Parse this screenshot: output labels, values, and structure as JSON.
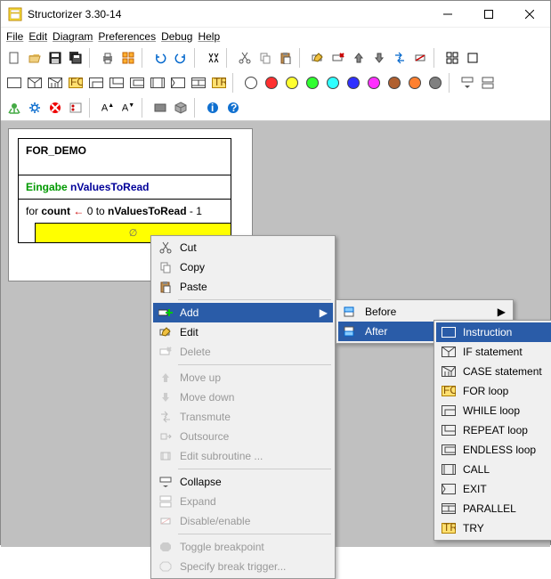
{
  "window": {
    "title": "Structorizer 3.30-14"
  },
  "menu": {
    "file": "File",
    "edit": "Edit",
    "diagram": "Diagram",
    "preferences": "Preferences",
    "debug": "Debug",
    "help": "Help"
  },
  "toolbar_colors": [
    "#ffffff",
    "#ff3030",
    "#ffff30",
    "#30ff30",
    "#30ffff",
    "#3030ff",
    "#ff30ff",
    "#b06030",
    "#ff8030",
    "#808080"
  ],
  "diagram": {
    "name": "FOR_DEMO",
    "input_kw": "Eingabe",
    "input_var": "nValuesToRead",
    "for_line_pre": "for ",
    "for_var": "count",
    "for_arrow": " ← ",
    "for_mid": "0 to ",
    "for_limit": "nValuesToRead",
    "for_suffix": " - 1",
    "body_placeholder": "∅"
  },
  "ctx1": {
    "cut": "Cut",
    "copy": "Copy",
    "paste": "Paste",
    "add": "Add",
    "edit": "Edit",
    "delete": "Delete",
    "moveup": "Move up",
    "movedown": "Move down",
    "transmute": "Transmute",
    "outsource": "Outsource",
    "editsub": "Edit subroutine ...",
    "collapse": "Collapse",
    "expand": "Expand",
    "disable": "Disable/enable",
    "togglebp": "Toggle breakpoint",
    "specbp": "Specify break trigger..."
  },
  "ctx2": {
    "before": "Before",
    "after": "After"
  },
  "ctx3": {
    "instruction": "Instruction",
    "ifstmt": "IF statement",
    "casestmt": "CASE statement",
    "forloop": "FOR loop",
    "whileloop": "WHILE loop",
    "repeatloop": "REPEAT loop",
    "endlessloop": "ENDLESS loop",
    "call": "CALL",
    "exit": "EXIT",
    "parallel": "PARALLEL",
    "try": "TRY"
  }
}
